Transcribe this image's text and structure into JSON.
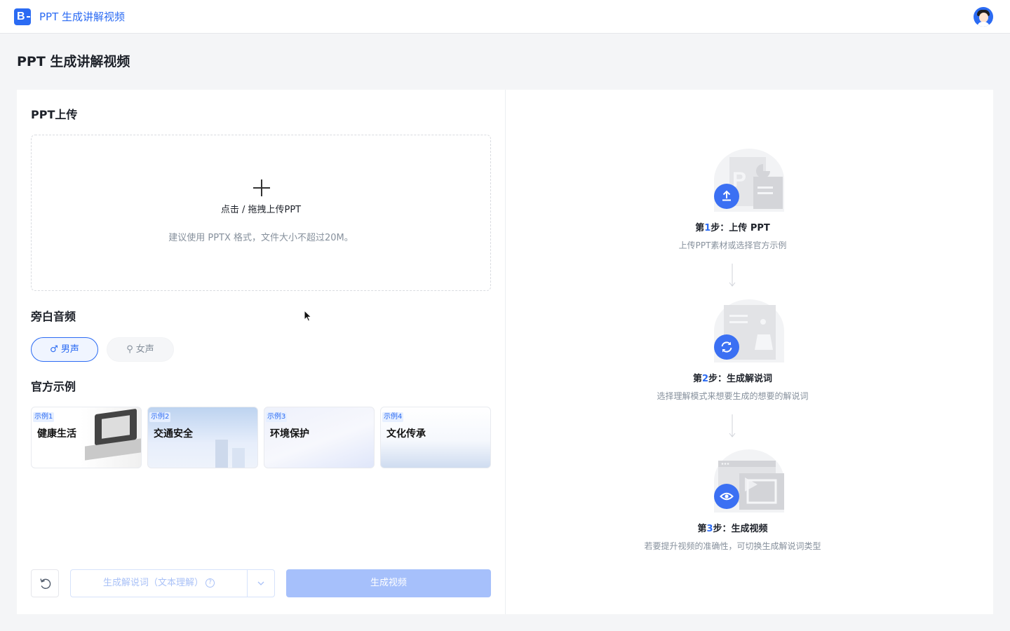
{
  "app": {
    "logo": "B",
    "title": "PPT 生成讲解视频"
  },
  "page": {
    "title": "PPT 生成讲解视频"
  },
  "upload": {
    "section": "PPT上传",
    "main": "点击 / 拖拽上传PPT",
    "hint": "建议使用 PPTX 格式，文件大小不超过20M。"
  },
  "voice": {
    "section": "旁白音频",
    "selected": "男声",
    "options": [
      {
        "label": "男声",
        "icon": "male-icon"
      },
      {
        "label": "女声",
        "icon": "female-icon"
      }
    ]
  },
  "examples": {
    "section": "官方示例",
    "items": [
      {
        "tag": "示例1",
        "title": "健康生活"
      },
      {
        "tag": "示例2",
        "title": "交通安全"
      },
      {
        "tag": "示例3",
        "title": "环境保护"
      },
      {
        "tag": "示例4",
        "title": "文化传承"
      }
    ]
  },
  "actions": {
    "generate_script": "生成解说词（文本理解）",
    "generate_video": "生成视频"
  },
  "steps": [
    {
      "prefix": "第",
      "num": "1",
      "suffix": "步：上传 PPT",
      "desc": "上传PPT素材或选择官方示例",
      "icon": "upload-icon"
    },
    {
      "prefix": "第",
      "num": "2",
      "suffix": "步：生成解说词",
      "desc": "选择理解模式来想要生成的想要的解说词",
      "icon": "refresh-icon"
    },
    {
      "prefix": "第",
      "num": "3",
      "suffix": "步：生成视频",
      "desc": "若要提升视频的准确性，可切换生成解说词类型",
      "icon": "eye-icon"
    }
  ],
  "colors": {
    "accent": "#2b6bf3",
    "disabled_button": "#a6c0fb"
  }
}
